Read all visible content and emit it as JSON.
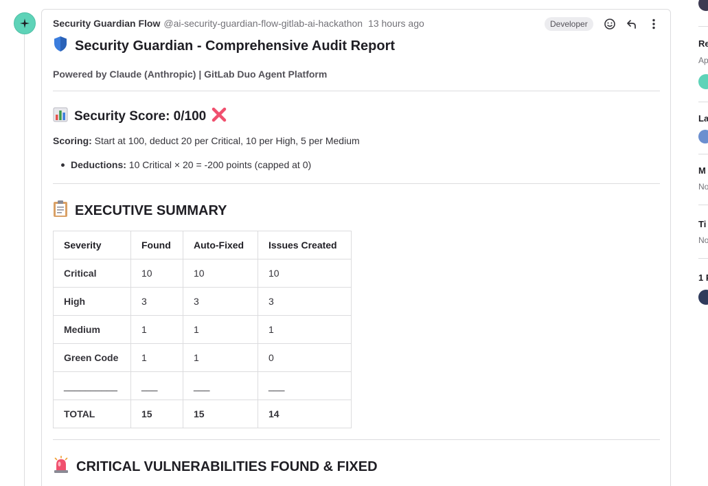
{
  "note": {
    "author_name": "Security Guardian Flow",
    "author_handle": "@ai-security-guardian-flow-gitlab-ai-hackathon",
    "time": "13 hours ago",
    "role_badge": "Developer",
    "actions": [
      "emoji-reaction",
      "reply",
      "more-actions"
    ]
  },
  "report": {
    "title": "Security Guardian - Comprehensive Audit Report",
    "title_icon": "shield",
    "subtitle": "Powered by Claude (Anthropic) | GitLab Duo Agent Platform",
    "score_heading": "Security Score: 0/100",
    "score_icon": "bar-chart",
    "score_status_icon": "cross-mark",
    "scoring_label": "Scoring:",
    "scoring_text": "Start at 100, deduct 20 per Critical, 10 per High, 5 per Medium",
    "deductions_label": "Deductions:",
    "deductions_text": "10 Critical × 20 = -200 points (capped at 0)",
    "summary_heading": "EXECUTIVE SUMMARY",
    "summary_icon": "clipboard",
    "critical_heading": "CRITICAL VULNERABILITIES FOUND & FIXED",
    "critical_icon": "rotating-light"
  },
  "summary_table": {
    "headers": [
      "Severity",
      "Found",
      "Auto-Fixed",
      "Issues Created"
    ],
    "rows": [
      [
        "Critical",
        "10",
        "10",
        "10"
      ],
      [
        "High",
        "3",
        "3",
        "3"
      ],
      [
        "Medium",
        "1",
        "1",
        "1"
      ],
      [
        "Green Code",
        "1",
        "1",
        "0"
      ],
      [
        "__________",
        "___",
        "___",
        "___"
      ],
      [
        "TOTAL",
        "15",
        "15",
        "14"
      ]
    ]
  },
  "sidebar": {
    "items": [
      {
        "title": "Re",
        "value": "Ap"
      },
      {
        "title": "La",
        "value": ""
      },
      {
        "title": "M",
        "value": "No"
      },
      {
        "title": "Ti",
        "value": "No"
      },
      {
        "title": "1 P",
        "value": ""
      }
    ]
  },
  "colors": {
    "ai_avatar": "#5ed3b8",
    "border": "#dcdcde",
    "muted_text": "#737278"
  }
}
